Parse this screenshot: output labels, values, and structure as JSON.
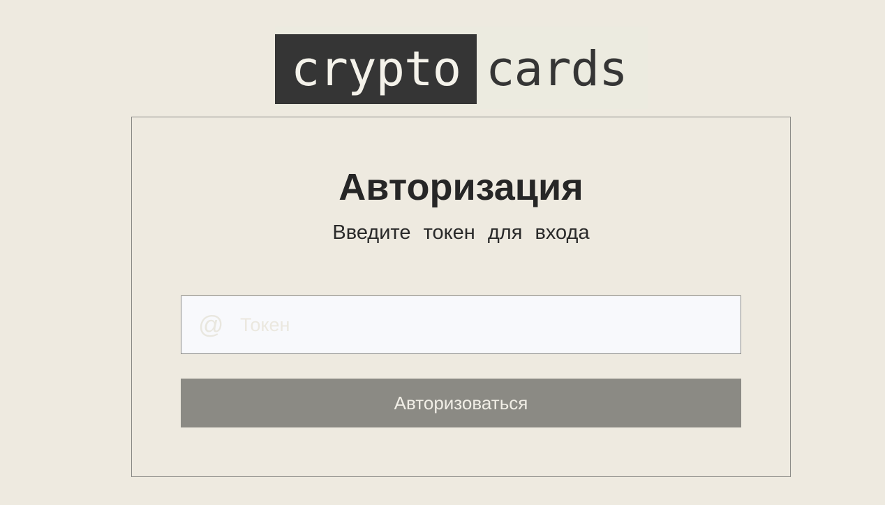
{
  "logo": {
    "part1": "crypto",
    "part2": "cards"
  },
  "auth": {
    "title": "Авторизация",
    "subtitle": "Введите токен для входа",
    "token_placeholder": "Токен",
    "token_value": "",
    "submit_label": "Авторизоваться",
    "icon": "at-icon"
  },
  "colors": {
    "background": "#eeeae0",
    "logo_dark": "#353535",
    "button": "#8b8a84",
    "input_bg": "#f8f9fc"
  }
}
